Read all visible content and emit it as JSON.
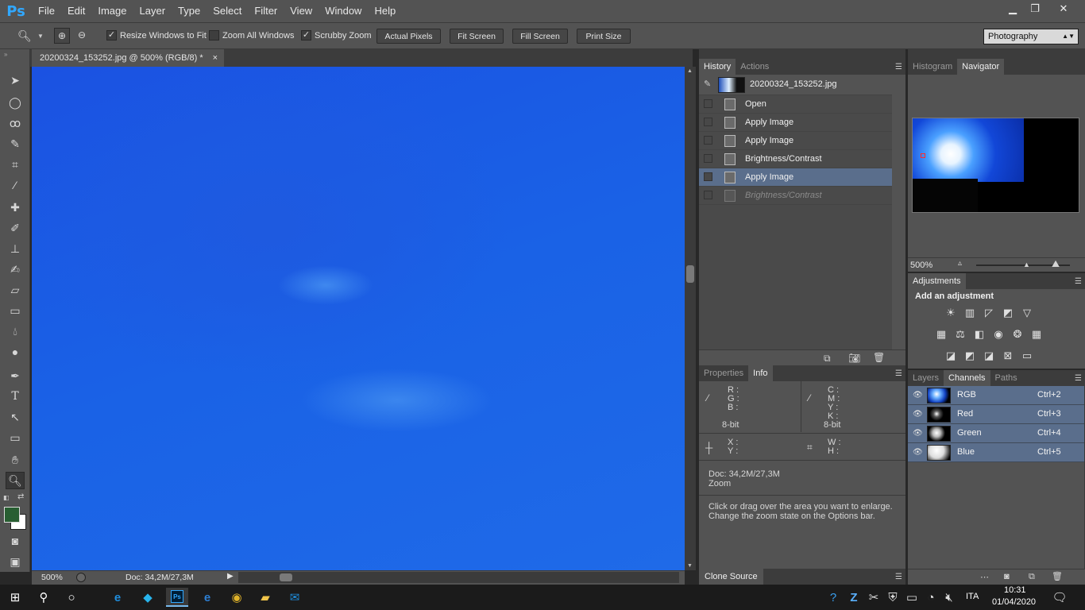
{
  "app": {
    "logo": "Ps"
  },
  "menu": [
    "File",
    "Edit",
    "Image",
    "Layer",
    "Type",
    "Select",
    "Filter",
    "View",
    "Window",
    "Help"
  ],
  "window_controls": {
    "minimize": "▁",
    "restore": "❐",
    "close": "✕"
  },
  "options": {
    "resize_windows": {
      "label": "Resize Windows to Fit",
      "checked": true
    },
    "zoom_all": {
      "label": "Zoom All Windows",
      "checked": false
    },
    "scrubby": {
      "label": "Scrubby Zoom",
      "checked": true
    },
    "buttons": [
      "Actual Pixels",
      "Fit Screen",
      "Fill Screen",
      "Print Size"
    ],
    "workspace": "Photography"
  },
  "document": {
    "tab_title": "20200324_153252.jpg @ 500% (RGB/8) *",
    "close": "×",
    "canvas_color": "#1a5de4"
  },
  "status": {
    "zoom": "500%",
    "doc": "Doc: 34,2M/27,3M"
  },
  "history": {
    "tabs": [
      "History",
      "Actions"
    ],
    "snapshot": "20200324_153252.jpg",
    "items": [
      {
        "label": "Open",
        "state": "normal"
      },
      {
        "label": "Apply Image",
        "state": "normal"
      },
      {
        "label": "Apply Image",
        "state": "normal"
      },
      {
        "label": "Brightness/Contrast",
        "state": "normal"
      },
      {
        "label": "Apply Image",
        "state": "selected"
      },
      {
        "label": "Brightness/Contrast",
        "state": "dimmed"
      }
    ]
  },
  "navigator": {
    "tabs": [
      "Histogram",
      "Navigator"
    ],
    "zoom": "500%"
  },
  "adjustments": {
    "tab": "Adjustments",
    "heading": "Add an adjustment"
  },
  "info": {
    "tabs": [
      "Properties",
      "Info"
    ],
    "rgb_labels": [
      "R :",
      "G :",
      "B :"
    ],
    "cmyk_labels": [
      "C :",
      "M :",
      "Y :",
      "K :"
    ],
    "bit_left": "8-bit",
    "bit_right": "8-bit",
    "xy": [
      "X :",
      "Y :"
    ],
    "wh": [
      "W :",
      "H :"
    ],
    "doc": "Doc: 34,2M/27,3M",
    "tool": "Zoom",
    "hint1": "Click or drag over the area you want to enlarge.",
    "hint2": "Change the zoom state on the Options bar."
  },
  "clone_source": "Clone Source",
  "layers": {
    "tabs": [
      "Layers",
      "Channels",
      "Paths"
    ],
    "channels": [
      {
        "name": "RGB",
        "shortcut": "Ctrl+2"
      },
      {
        "name": "Red",
        "shortcut": "Ctrl+3"
      },
      {
        "name": "Green",
        "shortcut": "Ctrl+4"
      },
      {
        "name": "Blue",
        "shortcut": "Ctrl+5"
      }
    ]
  },
  "taskbar": {
    "lang": "ITA",
    "time": "10:31",
    "date": "01/04/2020"
  }
}
